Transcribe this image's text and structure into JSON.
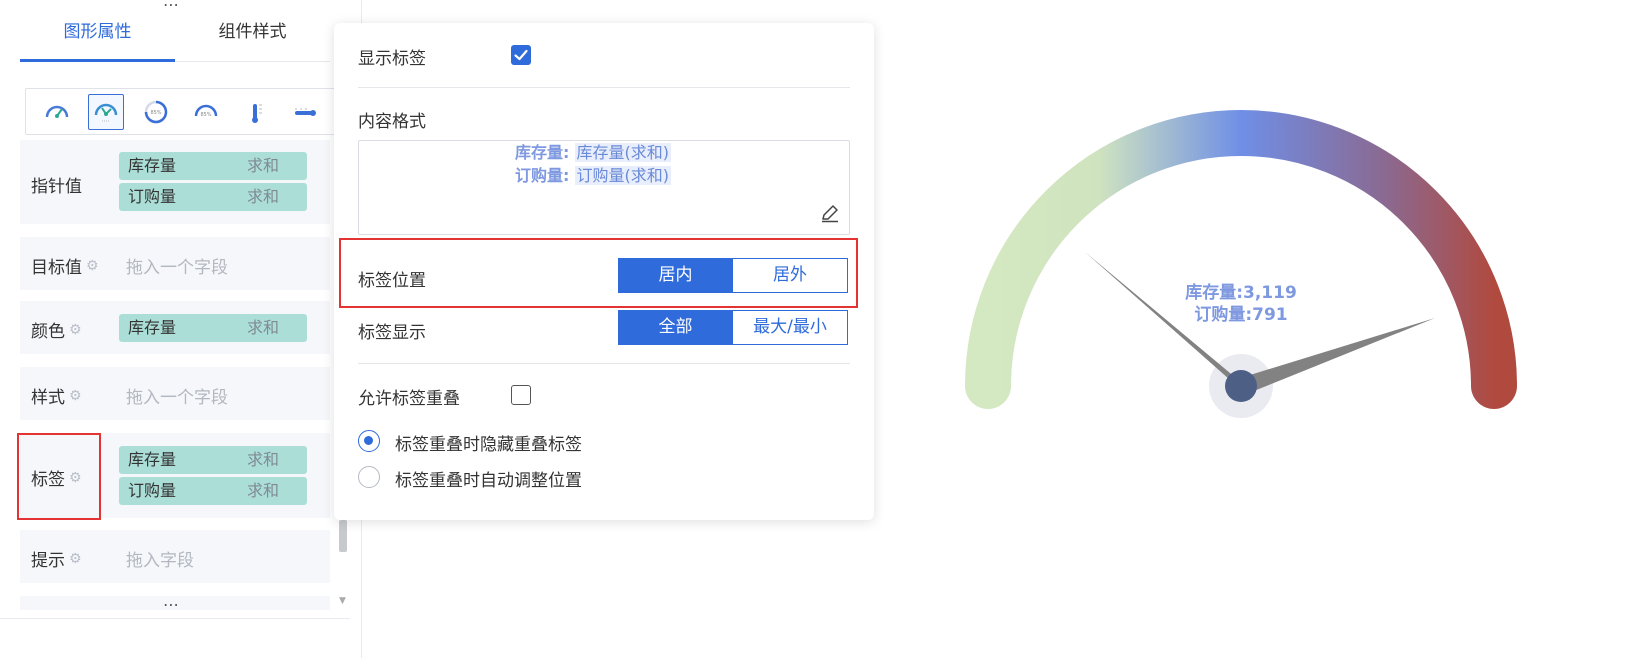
{
  "sidebar": {
    "tabs": [
      {
        "label": "图形属性",
        "active": true
      },
      {
        "label": "组件样式",
        "active": false
      }
    ],
    "chart_type_icons": [
      "gauge-needle-icon",
      "gauge-multi-needle-icon",
      "ring-percent-icon",
      "half-ring-percent-icon",
      "vertical-tube-icon",
      "horizontal-tube-icon"
    ],
    "fields": {
      "pointer": {
        "label": "指针值",
        "items": [
          {
            "name": "库存量",
            "agg": "求和"
          },
          {
            "name": "订购量",
            "agg": "求和"
          }
        ]
      },
      "target": {
        "label": "目标值",
        "placeholder": "拖入一个字段"
      },
      "color": {
        "label": "颜色",
        "items": [
          {
            "name": "库存量",
            "agg": "求和"
          }
        ]
      },
      "style": {
        "label": "样式",
        "placeholder": "拖入一个字段"
      },
      "tag": {
        "label": "标签",
        "items": [
          {
            "name": "库存量",
            "agg": "求和"
          },
          {
            "name": "订购量",
            "agg": "求和"
          }
        ]
      },
      "tooltip": {
        "label": "提示",
        "placeholder": "拖入字段"
      }
    }
  },
  "popover": {
    "show_label": {
      "label": "显示标签",
      "checked": true
    },
    "content_format": {
      "label": "内容格式",
      "lines": [
        {
          "key": "库存量:",
          "value": "库存量(求和)"
        },
        {
          "key": "订购量:",
          "value": "订购量(求和)"
        }
      ]
    },
    "label_position": {
      "label": "标签位置",
      "options": [
        "居内",
        "居外"
      ],
      "selected": "居内"
    },
    "label_display": {
      "label": "标签显示",
      "options": [
        "全部",
        "最大/最小"
      ],
      "selected": "全部"
    },
    "allow_overlap": {
      "label": "允许标签重叠",
      "checked": false
    },
    "overlap_options": [
      {
        "label": "标签重叠时隐藏重叠标签",
        "checked": true
      },
      {
        "label": "标签重叠时自动调整位置",
        "checked": false
      }
    ]
  },
  "gauge": {
    "labels": [
      "库存量:3,119",
      "订购量:791"
    ],
    "colors": {
      "start": "#d4e8c1",
      "mid": "#6f8fe6",
      "end": "#b04a3f",
      "needle": "#808080",
      "hub": "#4e5f86"
    }
  }
}
